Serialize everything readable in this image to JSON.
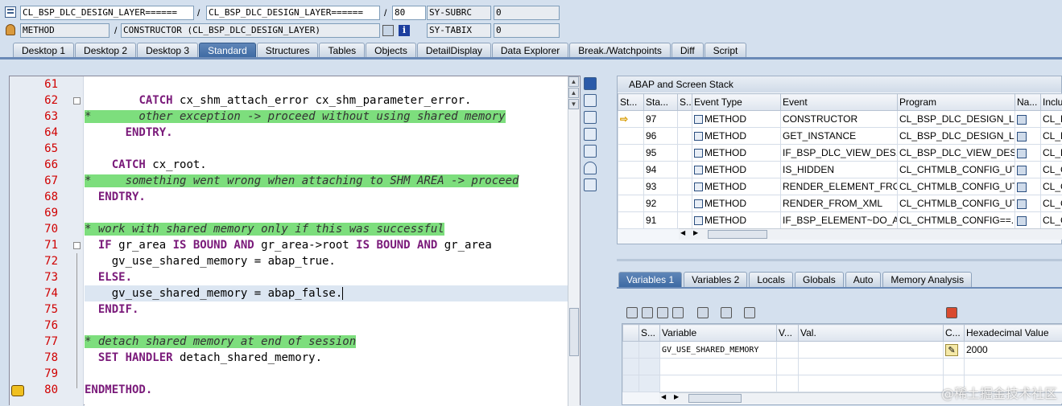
{
  "header": {
    "row1": {
      "program": "CL_BSP_DLC_DESIGN_LAYER======",
      "include": "CL_BSP_DLC_DESIGN_LAYER======",
      "line": "80",
      "sysfield": "SY-SUBRC",
      "sysvalue": "0",
      "sep1": "/",
      "sep2": "/"
    },
    "row2": {
      "event_type": "METHOD",
      "event": "CONSTRUCTOR (CL_BSP_DLC_DESIGN_LAYER)",
      "sysfield": "SY-TABIX",
      "sysvalue": "0",
      "sep1": "/"
    }
  },
  "tabs": [
    "Desktop 1",
    "Desktop 2",
    "Desktop 3",
    "Standard",
    "Structures",
    "Tables",
    "Objects",
    "DetailDisplay",
    "Data Explorer",
    "Break./Watchpoints",
    "Diff",
    "Script"
  ],
  "active_tab": "Standard",
  "code": {
    "line_numbers": [
      "61",
      "62",
      "63",
      "64",
      "65",
      "66",
      "67",
      "68",
      "69",
      "70",
      "71",
      "72",
      "73",
      "74",
      "75",
      "76",
      "77",
      "78",
      "79",
      "80"
    ],
    "lines": [
      {
        "parts": []
      },
      {
        "parts": [
          {
            "t": "        ",
            "c": "id"
          },
          {
            "t": "CATCH",
            "c": "kw"
          },
          {
            "t": " cx_shm_attach_error cx_shm_parameter_error.",
            "c": "id"
          }
        ]
      },
      {
        "parts": [
          {
            "t": "*       other exception -> proceed without using shared memory",
            "c": "cm"
          }
        ]
      },
      {
        "parts": [
          {
            "t": "      ",
            "c": "id"
          },
          {
            "t": "ENDTRY.",
            "c": "kw"
          }
        ]
      },
      {
        "parts": []
      },
      {
        "parts": [
          {
            "t": "    ",
            "c": "id"
          },
          {
            "t": "CATCH",
            "c": "kw"
          },
          {
            "t": " cx_root.",
            "c": "id"
          }
        ]
      },
      {
        "parts": [
          {
            "t": "*     something went wrong when attaching to SHM AREA -> proceed",
            "c": "cm"
          }
        ]
      },
      {
        "parts": [
          {
            "t": "  ",
            "c": "id"
          },
          {
            "t": "ENDTRY.",
            "c": "kw"
          }
        ]
      },
      {
        "parts": []
      },
      {
        "parts": [
          {
            "t": "* work with shared memory only if this was successful",
            "c": "cm"
          }
        ]
      },
      {
        "parts": [
          {
            "t": "  ",
            "c": "id"
          },
          {
            "t": "IF",
            "c": "kw"
          },
          {
            "t": " gr_area ",
            "c": "id"
          },
          {
            "t": "IS BOUND AND",
            "c": "kw"
          },
          {
            "t": " gr_area->root ",
            "c": "id"
          },
          {
            "t": "IS BOUND AND",
            "c": "kw"
          },
          {
            "t": " gr_area",
            "c": "id"
          }
        ]
      },
      {
        "parts": [
          {
            "t": "    gv_use_shared_memory = abap_true.",
            "c": "id"
          }
        ]
      },
      {
        "parts": [
          {
            "t": "  ",
            "c": "id"
          },
          {
            "t": "ELSE.",
            "c": "kw"
          }
        ]
      },
      {
        "parts": [
          {
            "t": "    gv_use_shared_memory = abap_false.",
            "c": "id"
          }
        ]
      },
      {
        "parts": [
          {
            "t": "  ",
            "c": "id"
          },
          {
            "t": "ENDIF.",
            "c": "kw"
          }
        ]
      },
      {
        "parts": []
      },
      {
        "parts": [
          {
            "t": "* detach shared memory at end of session",
            "c": "cm"
          }
        ]
      },
      {
        "parts": [
          {
            "t": "  ",
            "c": "id"
          },
          {
            "t": "SET HANDLER",
            "c": "kw"
          },
          {
            "t": " detach_shared_memory.",
            "c": "id"
          }
        ]
      },
      {
        "parts": []
      },
      {
        "parts": [
          {
            "t": "ENDMETHOD.",
            "c": "kw"
          }
        ]
      }
    ]
  },
  "stack": {
    "title": "ABAP and Screen Stack",
    "columns": [
      "St...",
      "Sta...",
      "S...",
      "Event Type",
      "Event",
      "Program",
      "Na...",
      "Inclu"
    ],
    "rows": [
      {
        "level": "97",
        "type": "METHOD",
        "event": "CONSTRUCTOR",
        "program": "CL_BSP_DLC_DESIGN_L...",
        "include": "CL_B",
        "current": true
      },
      {
        "level": "96",
        "type": "METHOD",
        "event": "GET_INSTANCE",
        "program": "CL_BSP_DLC_DESIGN_L...",
        "include": "CL_B",
        "current": false
      },
      {
        "level": "95",
        "type": "METHOD",
        "event": "IF_BSP_DLC_VIEW_DES...",
        "program": "CL_BSP_DLC_VIEW_DES...",
        "include": "CL_B",
        "current": false
      },
      {
        "level": "94",
        "type": "METHOD",
        "event": "IS_HIDDEN",
        "program": "CL_CHTMLB_CONFIG_UT...",
        "include": "CL_C",
        "current": false
      },
      {
        "level": "93",
        "type": "METHOD",
        "event": "RENDER_ELEMENT_FRO...",
        "program": "CL_CHTMLB_CONFIG_UT...",
        "include": "CL_C",
        "current": false
      },
      {
        "level": "92",
        "type": "METHOD",
        "event": "RENDER_FROM_XML",
        "program": "CL_CHTMLB_CONFIG_UT...",
        "include": "CL_C",
        "current": false
      },
      {
        "level": "91",
        "type": "METHOD",
        "event": "IF_BSP_ELEMENT~DO_A...",
        "program": "CL_CHTMLB_CONFIG==...",
        "include": "CL_C",
        "current": false
      }
    ]
  },
  "var_tabs": [
    "Variables 1",
    "Variables 2",
    "Locals",
    "Globals",
    "Auto",
    "Memory Analysis"
  ],
  "active_var_tab": "Variables 1",
  "variables": {
    "columns": [
      "S...",
      "Variable",
      "V...",
      "Val.",
      "C...",
      "Hexadecimal Value"
    ],
    "rows": [
      {
        "name": "GV_USE_SHARED_MEMORY",
        "value": "",
        "hex": "2000"
      }
    ]
  },
  "watermark": "@稀土掘金技术社区"
}
